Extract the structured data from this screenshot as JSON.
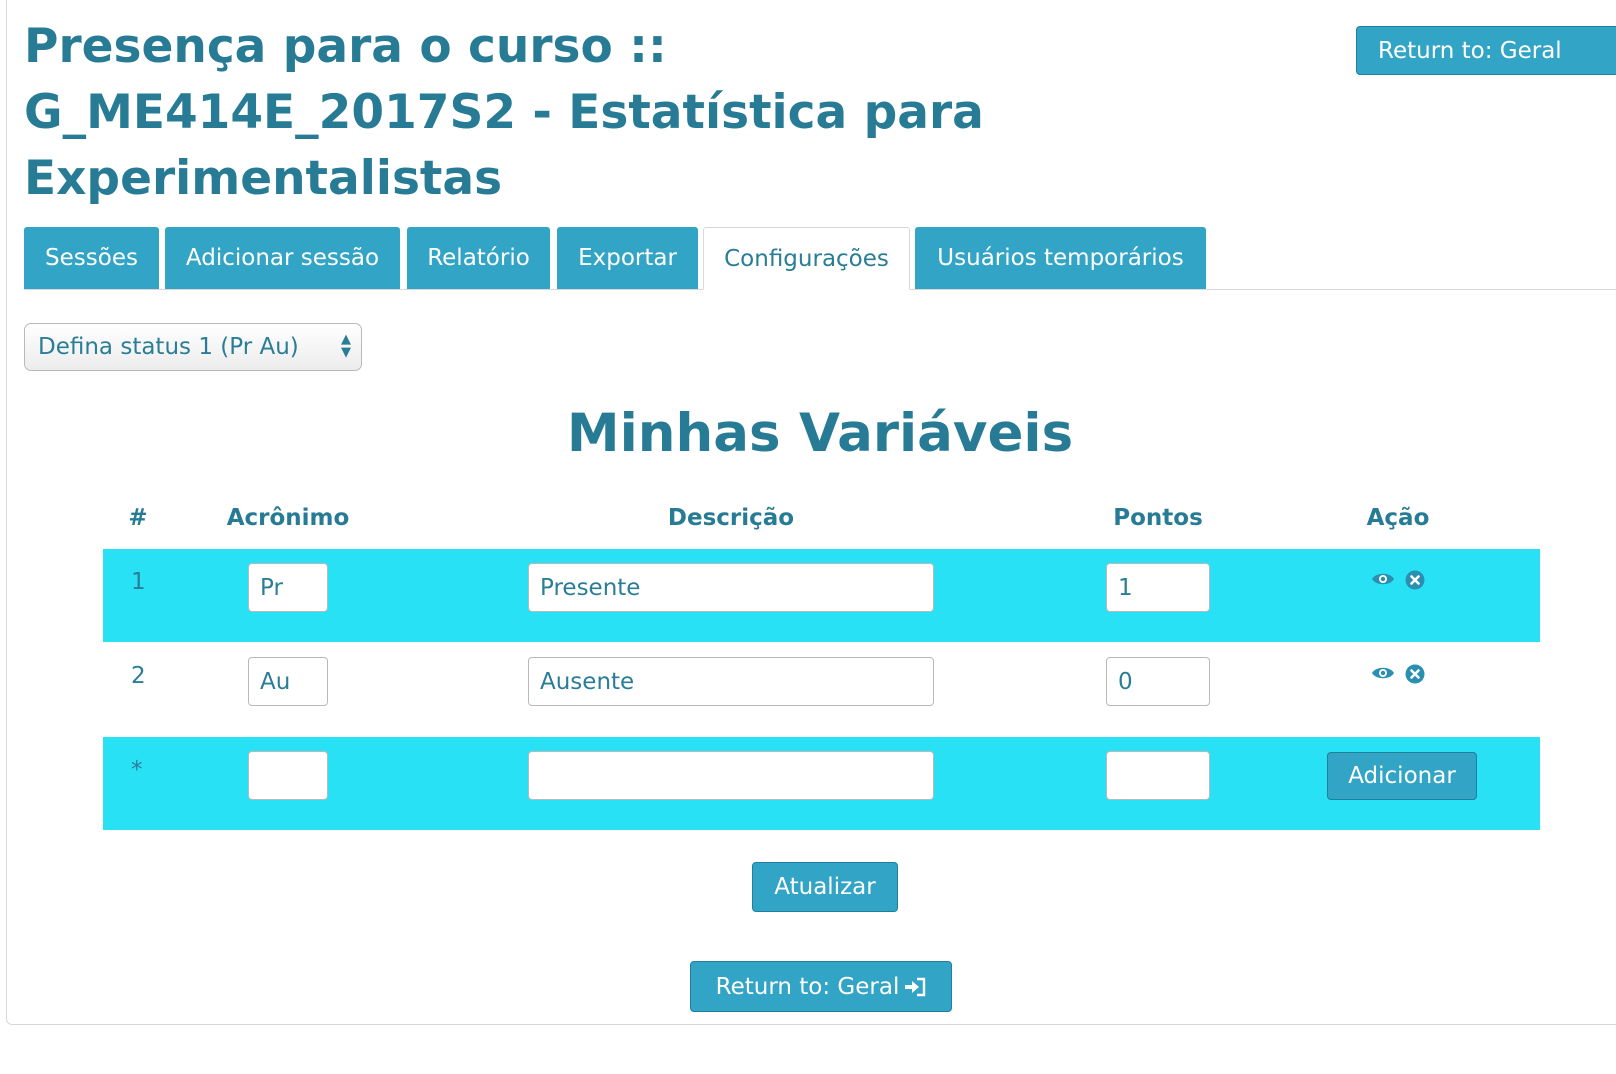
{
  "page": {
    "title": "Presença para o curso :: G_ME414E_2017S2 - Estatística para Experimentalistas",
    "return_top_label": "Return to: Geral",
    "return_bottom_label": "Return to: Geral"
  },
  "tabs": [
    {
      "label": "Sessões",
      "active": false
    },
    {
      "label": "Adicionar sessão",
      "active": false
    },
    {
      "label": "Relatório",
      "active": false
    },
    {
      "label": "Exportar",
      "active": false
    },
    {
      "label": "Configurações",
      "active": true
    },
    {
      "label": "Usuários temporários",
      "active": false
    }
  ],
  "status_select": {
    "value": "Defina status 1 (Pr Au)"
  },
  "section": {
    "heading": "Minhas Variáveis"
  },
  "table": {
    "headers": {
      "num": "#",
      "acronym": "Acrônimo",
      "description": "Descrição",
      "points": "Pontos",
      "action": "Ação"
    },
    "rows": [
      {
        "num": "1",
        "acronym": "Pr",
        "description": "Presente",
        "points": "1"
      },
      {
        "num": "2",
        "acronym": "Au",
        "description": "Ausente",
        "points": "0"
      }
    ],
    "new_row": {
      "num": "*",
      "acronym": "",
      "description": "",
      "points": "",
      "add_label": "Adicionar"
    }
  },
  "buttons": {
    "update_label": "Atualizar"
  },
  "colors": {
    "primary": "#32a4c6",
    "row_highlight": "#29e1f5",
    "heading": "#277b95"
  },
  "icons": {
    "visibility": "eye-icon",
    "delete": "delete-icon",
    "return": "sign-in-icon"
  }
}
